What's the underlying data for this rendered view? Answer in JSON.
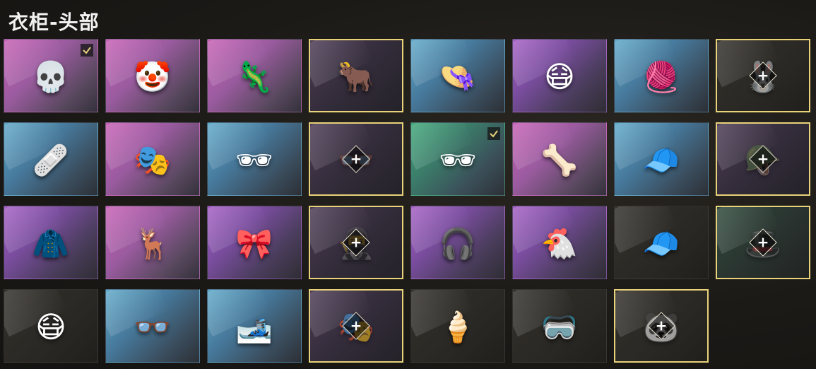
{
  "title": "衣柜-头部",
  "slots": [
    {
      "name": "gold-skull-mask-item",
      "bg": "pink",
      "icon": "💀",
      "equipped": true,
      "selected": false,
      "empty": false
    },
    {
      "name": "clown-mask-item",
      "bg": "pink",
      "icon": "🤡",
      "equipped": false,
      "selected": false,
      "empty": false
    },
    {
      "name": "lizard-mask-item",
      "bg": "pink",
      "icon": "🦎",
      "equipped": false,
      "selected": false,
      "empty": false
    },
    {
      "name": "bull-helmet-item",
      "bg": "darkpurple",
      "icon": "🐂",
      "equipped": false,
      "selected": true,
      "empty": false
    },
    {
      "name": "bucket-hat-item",
      "bg": "blue",
      "icon": "👒",
      "equipped": false,
      "selected": false,
      "empty": false
    },
    {
      "name": "bone-face-mask-item",
      "bg": "purple",
      "icon": "😷",
      "equipped": false,
      "selected": false,
      "empty": false
    },
    {
      "name": "rasta-beanie-item",
      "bg": "blue",
      "icon": "🧶",
      "equipped": false,
      "selected": false,
      "empty": false
    },
    {
      "name": "bunny-hood-slot",
      "bg": "dark",
      "icon": "🐰",
      "equipped": false,
      "selected": true,
      "empty": true
    },
    {
      "name": "pink-sleep-mask-item",
      "bg": "blue",
      "icon": "🩹",
      "equipped": false,
      "selected": false,
      "empty": false
    },
    {
      "name": "neon-gas-mask-item",
      "bg": "pink",
      "icon": "🎭",
      "equipped": false,
      "selected": false,
      "empty": false
    },
    {
      "name": "sport-sunglasses-item",
      "bg": "blue",
      "icon": "🕶",
      "equipped": false,
      "selected": false,
      "empty": false
    },
    {
      "name": "red-glasses-slot",
      "bg": "darkpurple",
      "icon": "👓",
      "equipped": false,
      "selected": true,
      "empty": true
    },
    {
      "name": "white-sunglasses-item",
      "bg": "green",
      "icon": "🕶",
      "equipped": true,
      "selected": false,
      "empty": false
    },
    {
      "name": "spine-headpiece-item",
      "bg": "pink",
      "icon": "🦴",
      "equipped": false,
      "selected": false,
      "empty": false
    },
    {
      "name": "red-cap-item",
      "bg": "blue",
      "icon": "🧢",
      "equipped": false,
      "selected": false,
      "empty": false
    },
    {
      "name": "camo-helmet-slot",
      "bg": "darkpurple",
      "icon": "🪖",
      "equipped": false,
      "selected": true,
      "empty": true
    },
    {
      "name": "black-hood-item",
      "bg": "purple",
      "icon": "🧥",
      "equipped": false,
      "selected": false,
      "empty": false
    },
    {
      "name": "reindeer-mask-item",
      "bg": "pink",
      "icon": "🦌",
      "equipped": false,
      "selected": false,
      "empty": false
    },
    {
      "name": "cat-ear-headband-item",
      "bg": "purple",
      "icon": "🎀",
      "equipped": false,
      "selected": false,
      "empty": false
    },
    {
      "name": "black-hood-slot",
      "bg": "darkpurple",
      "icon": "🥷",
      "equipped": false,
      "selected": true,
      "empty": true
    },
    {
      "name": "pilot-cap-headset-item",
      "bg": "purple",
      "icon": "🎧",
      "equipped": false,
      "selected": false,
      "empty": false
    },
    {
      "name": "chicken-mask-item",
      "bg": "purple",
      "icon": "🐔",
      "equipped": false,
      "selected": false,
      "empty": false
    },
    {
      "name": "black-cap-item",
      "bg": "dark",
      "icon": "🧢",
      "equipped": false,
      "selected": false,
      "empty": false
    },
    {
      "name": "black-visor-slot",
      "bg": "darkgreen",
      "icon": "🎩",
      "equipped": false,
      "selected": true,
      "empty": true
    },
    {
      "name": "black-face-mask-item",
      "bg": "dark",
      "icon": "😷",
      "equipped": false,
      "selected": false,
      "empty": false
    },
    {
      "name": "black-glasses-item",
      "bg": "blue",
      "icon": "👓",
      "equipped": false,
      "selected": false,
      "empty": false
    },
    {
      "name": "black-beanie-item",
      "bg": "blue",
      "icon": "🎿",
      "equipped": false,
      "selected": false,
      "empty": false
    },
    {
      "name": "black-theater-mask-slot",
      "bg": "darkpurple",
      "icon": "🎭",
      "equipped": false,
      "selected": true,
      "empty": true
    },
    {
      "name": "ice-cream-hat-item",
      "bg": "dark",
      "icon": "🍦",
      "equipped": false,
      "selected": false,
      "empty": false
    },
    {
      "name": "dark-goggles-item",
      "bg": "dark",
      "icon": "🥽",
      "equipped": false,
      "selected": false,
      "empty": false
    },
    {
      "name": "panda-hood-slot",
      "bg": "dark",
      "icon": "🐼",
      "equipped": false,
      "selected": true,
      "empty": true
    }
  ]
}
